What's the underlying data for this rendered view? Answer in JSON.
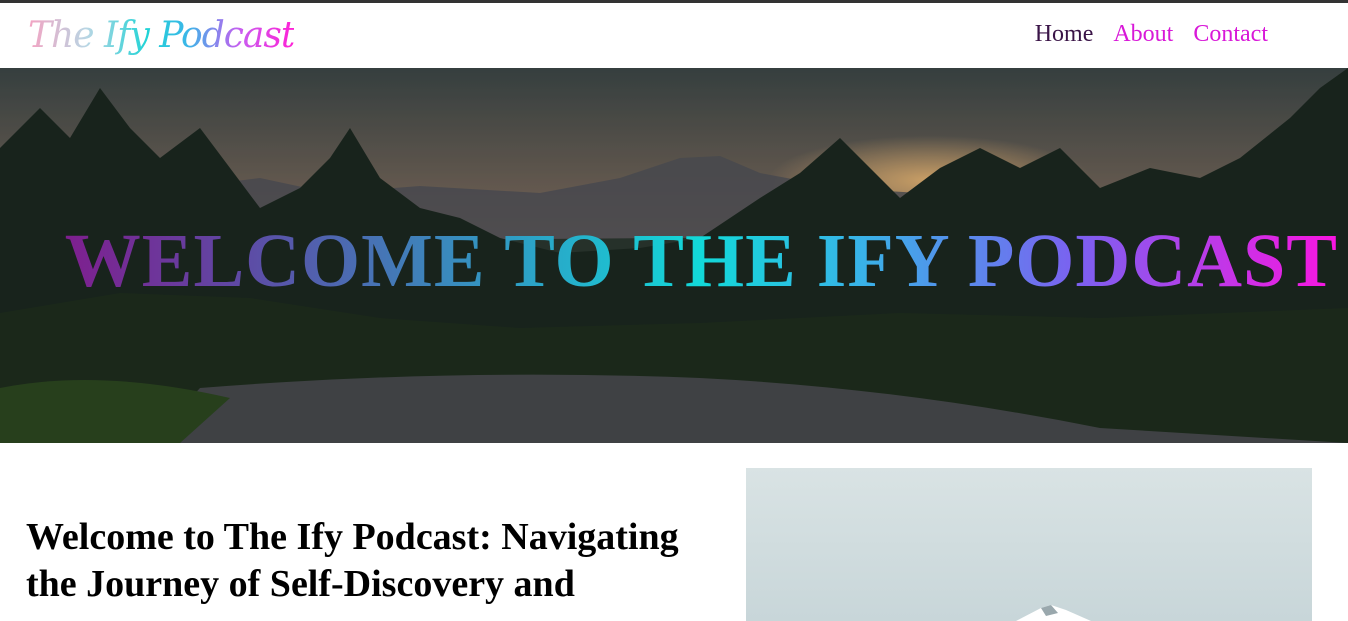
{
  "header": {
    "logo_text": "The Ify Podcast",
    "nav": [
      {
        "label": "Home"
      },
      {
        "label": "About"
      },
      {
        "label": "Contact"
      }
    ]
  },
  "hero": {
    "title": "WELCOME TO THE IFY PODCAST"
  },
  "main": {
    "heading": "Welcome to The Ify Podcast: Navigating the Journey of Self-Discovery and"
  },
  "colors": {
    "nav_active": "#3a1447",
    "nav_link": "#d818d8",
    "title_gradient_start": "#8a0f86",
    "title_gradient_mid": "#12d9d9",
    "title_gradient_end": "#ff12e0"
  }
}
